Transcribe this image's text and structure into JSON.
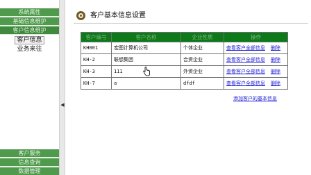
{
  "sidebar": {
    "top_items": [
      {
        "label": "系统属性"
      },
      {
        "label": "基础信息维护"
      },
      {
        "label": "客户信息维护"
      }
    ],
    "sub_items": [
      {
        "label": "客户信息"
      },
      {
        "label": "业务来往"
      }
    ],
    "bottom_items": [
      {
        "label": "客户服务"
      },
      {
        "label": "信息查询"
      },
      {
        "label": "数据管理"
      }
    ]
  },
  "main": {
    "title": "客户基本信息设置",
    "table": {
      "headers": [
        "客户编号",
        "客户名称",
        "企业性质",
        "操作"
      ],
      "rows": [
        {
          "id": "KH001",
          "name": "宏图计算机公司",
          "type": "个体企业",
          "view": "查看客户全部信息",
          "delete": "删除"
        },
        {
          "id": "KH-2",
          "name": "联想集团",
          "type": "合资企业",
          "view": "查看客户全部信息",
          "delete": "删除"
        },
        {
          "id": "KH-3",
          "name": "111",
          "type": "外资企业",
          "view": "查看客户全部信息",
          "delete": "删除"
        },
        {
          "id": "KH-7",
          "name": "a",
          "type": "dfdf",
          "view": "查看客户全部信息",
          "delete": "删除"
        }
      ]
    },
    "add_link": "添加客户的基本信息"
  },
  "colors": {
    "sidebar_green": "#4f9a4d",
    "table_header_green": "#0d7a19",
    "link_blue": "#1b1bd6"
  }
}
